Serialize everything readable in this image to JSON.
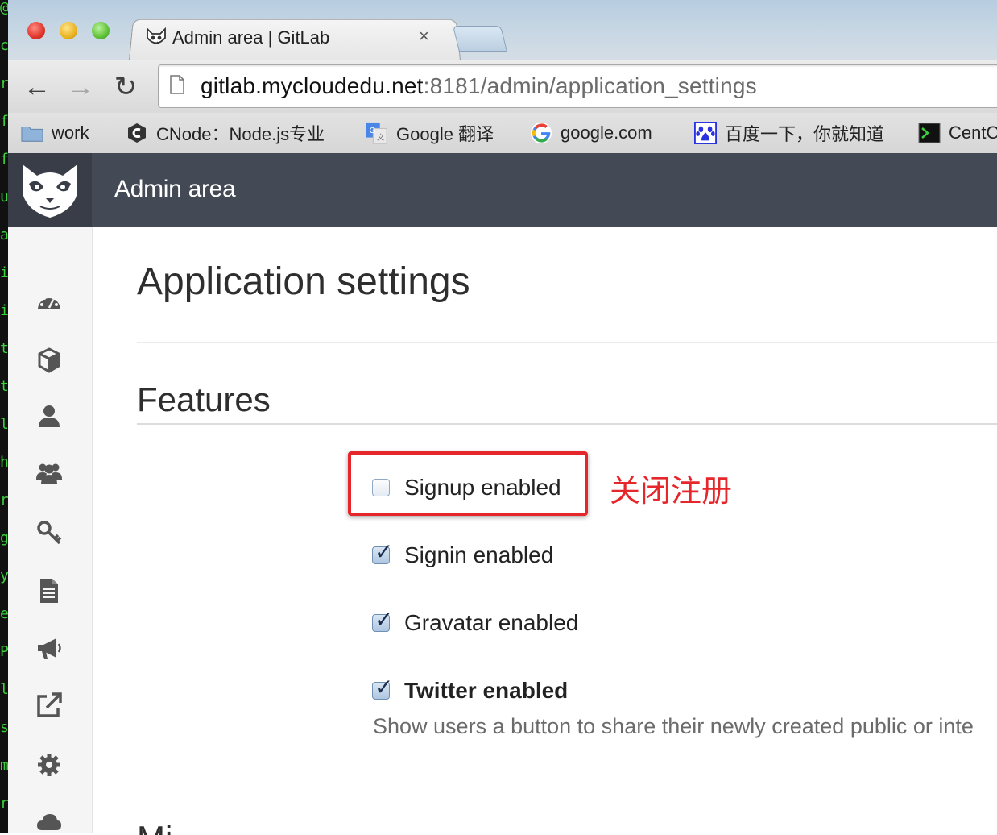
{
  "terminal": {
    "glyphs": [
      "@",
      "c",
      "r",
      "f",
      "f",
      "u",
      "a",
      "i",
      "i",
      "t",
      "t",
      "l",
      "h",
      "r",
      "g",
      "y",
      "e",
      "P",
      "l",
      "s",
      "m",
      "r"
    ]
  },
  "browser": {
    "tab": {
      "title": "Admin area | GitLab",
      "close": "×"
    },
    "nav": {
      "back": "←",
      "forward": "→",
      "reload": "↻"
    },
    "url": {
      "host": "gitlab.mycloudedu.net",
      "path": ":8181/admin/application_settings"
    },
    "bookmarks": [
      {
        "label": "work",
        "icon": "folder-icon"
      },
      {
        "label": "CNode：Node.js专业",
        "icon": "cnode-icon"
      },
      {
        "label": "Google 翻译",
        "icon": "google-translate-icon"
      },
      {
        "label": "google.com",
        "icon": "google-icon"
      },
      {
        "label": "百度一下，你就知道",
        "icon": "baidu-paw-icon"
      },
      {
        "label": "CentO",
        "icon": "terminal-icon"
      }
    ]
  },
  "header": {
    "title": "Admin area",
    "logo": "gitlab-fox-logo"
  },
  "sidebar": {
    "items": [
      {
        "icon": "dashboard-icon"
      },
      {
        "icon": "cube-icon"
      },
      {
        "icon": "user-icon"
      },
      {
        "icon": "group-icon"
      },
      {
        "icon": "key-icon"
      },
      {
        "icon": "document-icon"
      },
      {
        "icon": "megaphone-icon"
      },
      {
        "icon": "external-link-icon"
      },
      {
        "icon": "gear-icon"
      },
      {
        "icon": "cloud-icon"
      }
    ]
  },
  "main": {
    "page_title": "Application settings",
    "features_title": "Features",
    "checkboxes": [
      {
        "label": "Signup enabled",
        "checked": false
      },
      {
        "label": "Signin enabled",
        "checked": true
      },
      {
        "label": "Gravatar enabled",
        "checked": true
      },
      {
        "label": "Twitter enabled",
        "checked": true
      }
    ],
    "twitter_help": "Show users a button to share their newly created public or inte",
    "next_section": "Mi"
  },
  "annotation": {
    "text": "关闭注册",
    "color": "#e5262a"
  },
  "colors": {
    "header_bg": "#444a55",
    "logo_bg": "#383d47",
    "sidebar_bg": "#f5f5f5",
    "annotation_red": "#e5262a"
  }
}
